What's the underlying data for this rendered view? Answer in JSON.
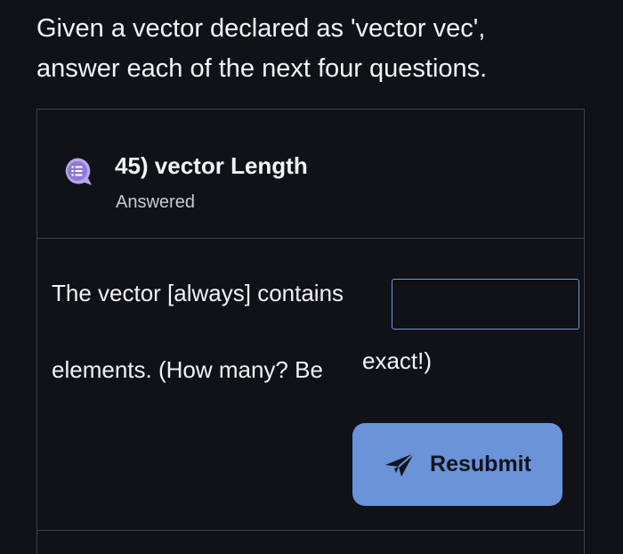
{
  "intro": {
    "line1": "Given a vector declared as 'vector vec',",
    "line2": "answer each of the next four questions."
  },
  "question": {
    "title": "45) vector Length",
    "status": "Answered",
    "icon": "question-list-icon",
    "text_before_input": "The vector [always] contains",
    "answer_value": "",
    "text_after_input_1": "elements. (How many? Be",
    "text_after_input_2": "exact!)"
  },
  "actions": {
    "resubmit_label": "Resubmit",
    "resubmit_icon": "paper-plane-icon"
  },
  "colors": {
    "background": "#101218",
    "accent": "#6a93d8",
    "icon_purple": "#b9a6ec",
    "border": "#3b4250"
  }
}
